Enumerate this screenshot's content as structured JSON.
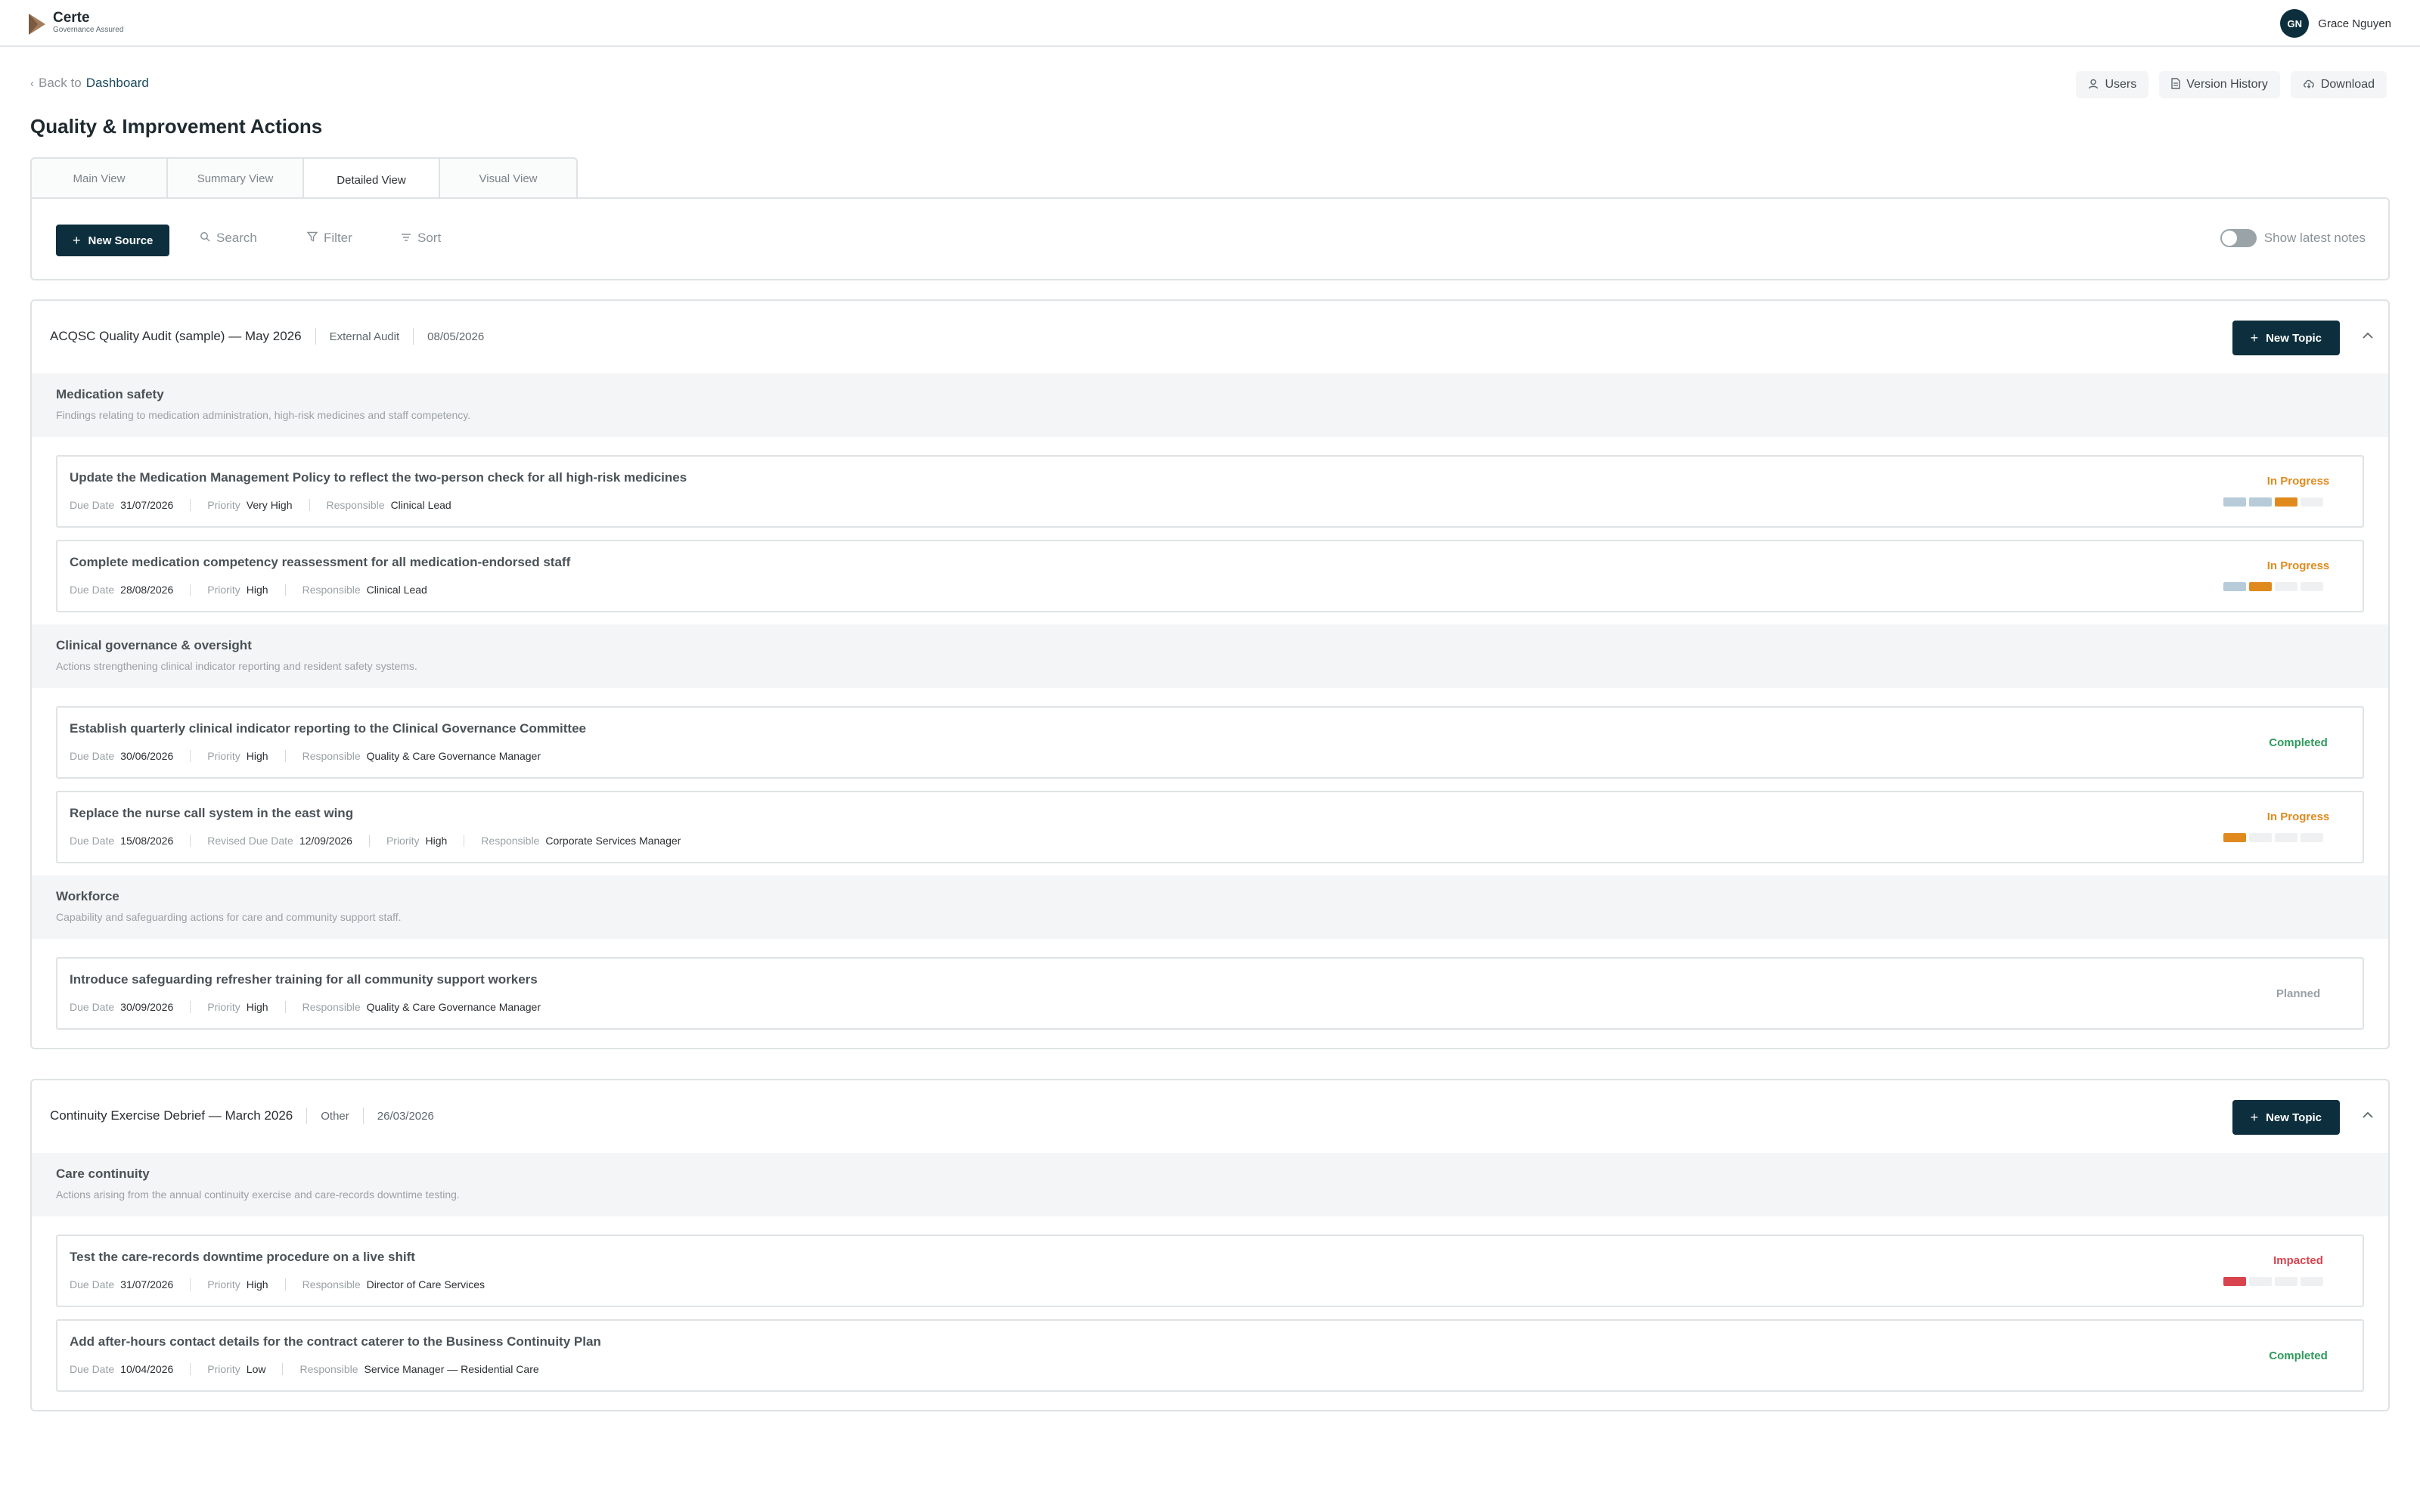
{
  "app": {
    "name": "Certe",
    "tagline": "Governance Assured"
  },
  "user": {
    "initials": "GN",
    "name": "Grace Nguyen"
  },
  "nav": {
    "back_prefix": "Back to",
    "back_link": "Dashboard"
  },
  "page": {
    "title": "Quality & Improvement Actions"
  },
  "top_actions": [
    {
      "label": "Users",
      "icon": "user-icon"
    },
    {
      "label": "Version History",
      "icon": "document-icon"
    },
    {
      "label": "Download",
      "icon": "cloud-download-icon"
    }
  ],
  "tabs": [
    {
      "label": "Main View"
    },
    {
      "label": "Summary View"
    },
    {
      "label": "Detailed View",
      "active": true
    },
    {
      "label": "Visual View"
    }
  ],
  "toolbar": {
    "new_source": "New Source",
    "search": "Search",
    "filter": "Filter",
    "sort": "Sort",
    "toggle_label": "Show latest notes",
    "toggle_on": false
  },
  "colors": {
    "primary": "#0d2f3d",
    "in_progress": "#e08a1e",
    "completed": "#2f9a5c",
    "impacted": "#d9434e",
    "planned": "#9aa1a5",
    "bar_done": "#b8cbd8",
    "bar_empty": "#eef0f1"
  },
  "sources": [
    {
      "title": "ACQSC Quality Audit (sample) — May 2026",
      "type": "External Audit",
      "date": "08/05/2026",
      "new_topic": "New Topic",
      "topics": [
        {
          "title": "Medication safety",
          "description": "Findings relating to medication administration, high-risk medicines and staff competency.",
          "actions": [
            {
              "title": "Update the Medication Management Policy to reflect the two-person check for all high-risk medicines",
              "fields": [
                {
                  "label": "Due Date",
                  "value": "31/07/2026"
                },
                {
                  "label": "Priority",
                  "value": "Very High"
                },
                {
                  "label": "Responsible",
                  "value": "Clinical Lead"
                }
              ],
              "status": "In Progress",
              "status_class": "progress",
              "stage": 3,
              "stages": 4
            },
            {
              "title": "Complete medication competency reassessment for all medication-endorsed staff",
              "fields": [
                {
                  "label": "Due Date",
                  "value": "28/08/2026"
                },
                {
                  "label": "Priority",
                  "value": "High"
                },
                {
                  "label": "Responsible",
                  "value": "Clinical Lead"
                }
              ],
              "status": "In Progress",
              "status_class": "progress",
              "stage": 2,
              "stages": 4
            }
          ]
        },
        {
          "title": "Clinical governance & oversight",
          "description": "Actions strengthening clinical indicator reporting and resident safety systems.",
          "actions": [
            {
              "title": "Establish quarterly clinical indicator reporting to the Clinical Governance Committee",
              "fields": [
                {
                  "label": "Due Date",
                  "value": "30/06/2026"
                },
                {
                  "label": "Priority",
                  "value": "High"
                },
                {
                  "label": "Responsible",
                  "value": "Quality & Care Governance Manager"
                }
              ],
              "status": "Completed",
              "status_class": "completed",
              "stage": 0,
              "stages": 0
            },
            {
              "title": "Replace the nurse call system in the east wing",
              "fields": [
                {
                  "label": "Due Date",
                  "value": "15/08/2026"
                },
                {
                  "label": "Revised Due Date",
                  "value": "12/09/2026"
                },
                {
                  "label": "Priority",
                  "value": "High"
                },
                {
                  "label": "Responsible",
                  "value": "Corporate Services Manager"
                }
              ],
              "status": "In Progress",
              "status_class": "progress",
              "stage": 1,
              "stages": 4
            }
          ]
        },
        {
          "title": "Workforce",
          "description": "Capability and safeguarding actions for care and community support staff.",
          "actions": [
            {
              "title": "Introduce safeguarding refresher training for all community support workers",
              "fields": [
                {
                  "label": "Due Date",
                  "value": "30/09/2026"
                },
                {
                  "label": "Priority",
                  "value": "High"
                },
                {
                  "label": "Responsible",
                  "value": "Quality & Care Governance Manager"
                }
              ],
              "status": "Planned",
              "status_class": "planned",
              "stage": 0,
              "stages": 0
            }
          ]
        }
      ]
    },
    {
      "title": "Continuity Exercise Debrief — March 2026",
      "type": "Other",
      "date": "26/03/2026",
      "new_topic": "New Topic",
      "topics": [
        {
          "title": "Care continuity",
          "description": "Actions arising from the annual continuity exercise and care-records downtime testing.",
          "actions": [
            {
              "title": "Test the care-records downtime procedure on a live shift",
              "fields": [
                {
                  "label": "Due Date",
                  "value": "31/07/2026"
                },
                {
                  "label": "Priority",
                  "value": "High"
                },
                {
                  "label": "Responsible",
                  "value": "Director of Care Services"
                }
              ],
              "status": "Impacted",
              "status_class": "impacted",
              "stage": 1,
              "stages": 4
            },
            {
              "title": "Add after-hours contact details for the contract caterer to the Business Continuity Plan",
              "fields": [
                {
                  "label": "Due Date",
                  "value": "10/04/2026"
                },
                {
                  "label": "Priority",
                  "value": "Low"
                },
                {
                  "label": "Responsible",
                  "value": "Service Manager — Residential Care"
                }
              ],
              "status": "Completed",
              "status_class": "completed",
              "stage": 0,
              "stages": 0
            }
          ]
        }
      ]
    }
  ]
}
